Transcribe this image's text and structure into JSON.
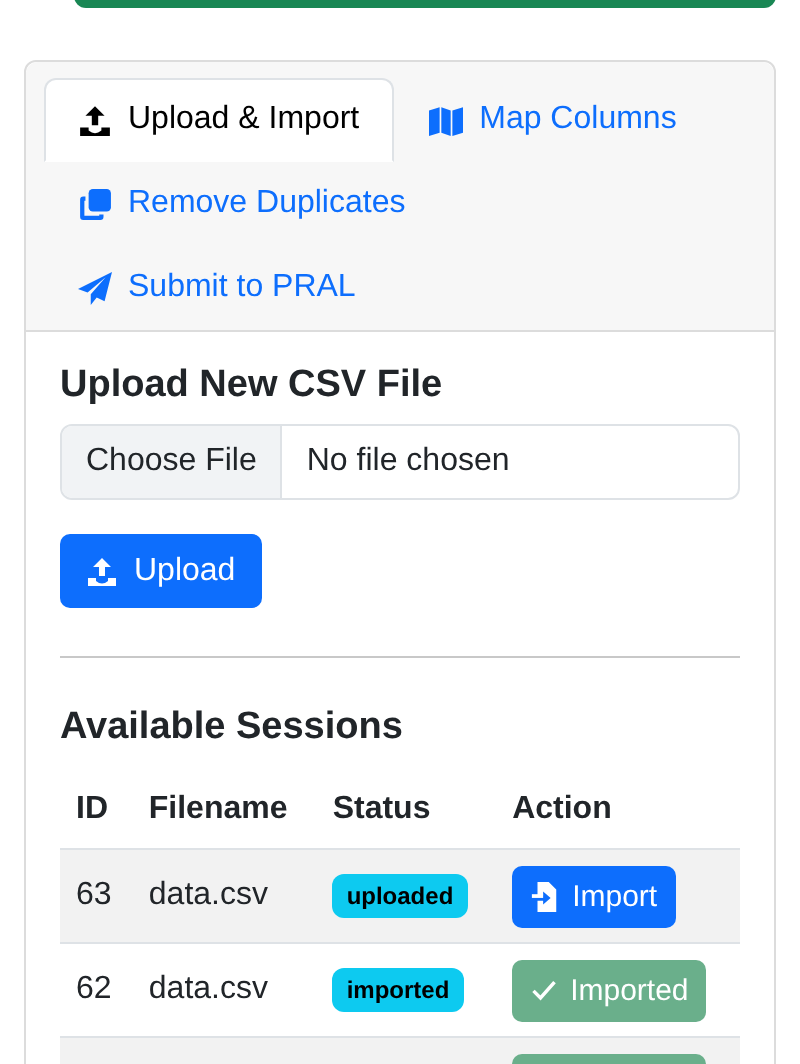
{
  "tabs": [
    {
      "label": "Upload & Import",
      "selected": true
    },
    {
      "label": "Map Columns",
      "selected": false
    },
    {
      "label": "Remove Duplicates",
      "selected": false
    },
    {
      "label": "Submit to PRAL",
      "selected": false
    }
  ],
  "upload": {
    "heading": "Upload New CSV File",
    "choose_button": "Choose File",
    "file_status": "No file chosen",
    "upload_button": "Upload"
  },
  "sessions": {
    "heading": "Available Sessions",
    "columns": [
      "ID",
      "Filename",
      "Status",
      "Action"
    ],
    "rows": [
      {
        "id": "63",
        "filename": "data.csv",
        "status": "uploaded",
        "action": {
          "kind": "import",
          "label": "Import"
        }
      },
      {
        "id": "62",
        "filename": "data.csv",
        "status": "imported",
        "action": {
          "kind": "done",
          "label": "Imported"
        }
      },
      {
        "action": {
          "kind": "done"
        }
      }
    ]
  }
}
